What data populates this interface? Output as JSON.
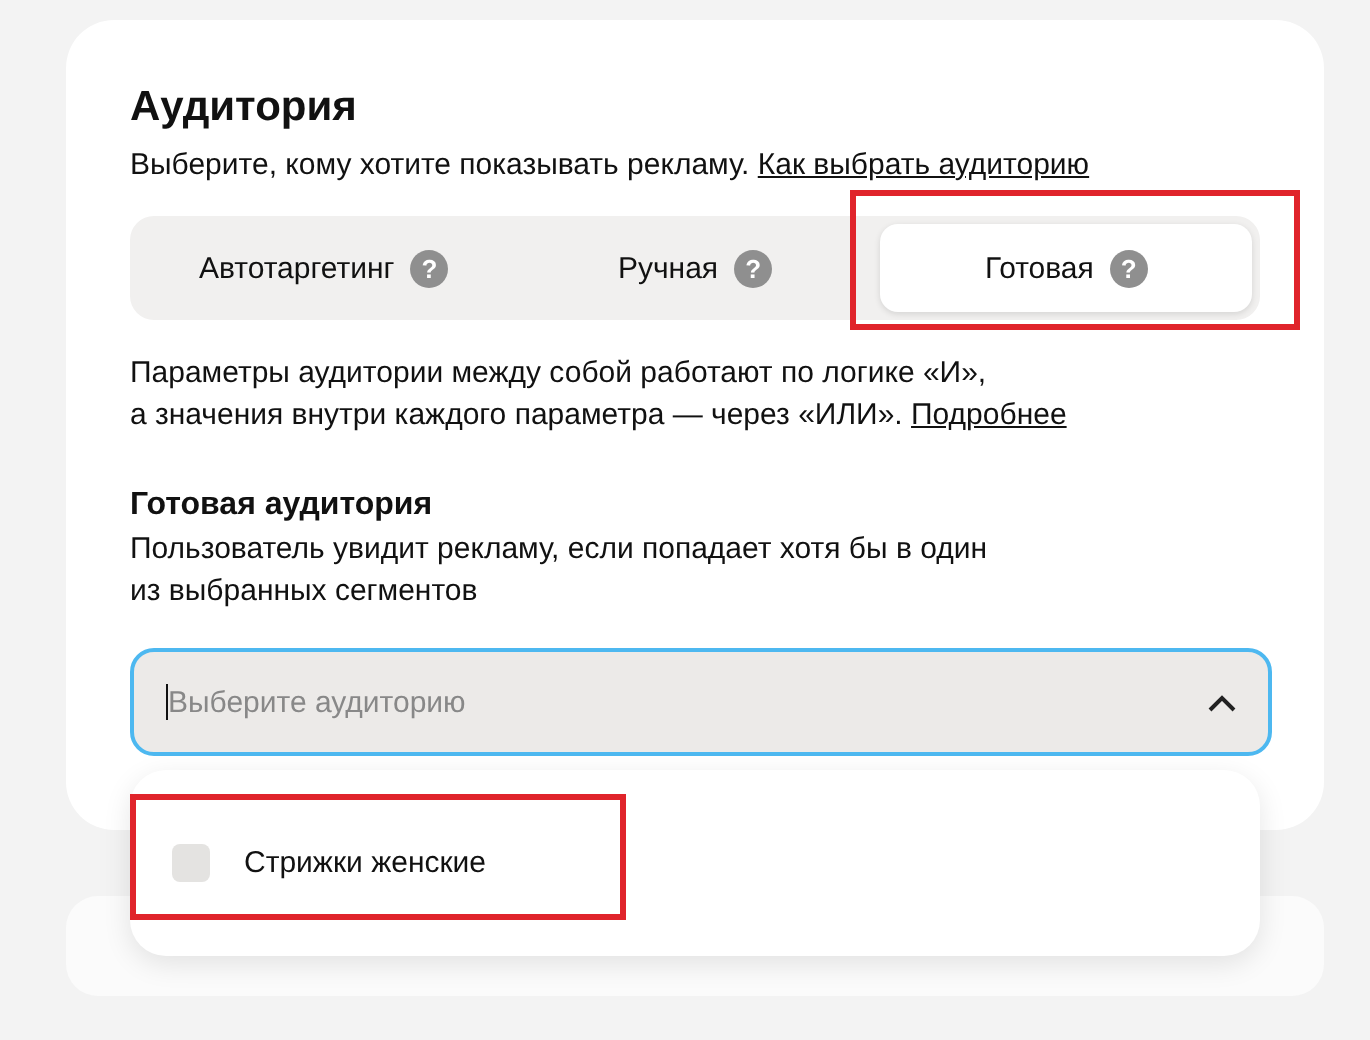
{
  "section": {
    "title": "Аудитория",
    "subtitle": "Выберите, кому хотите показывать рекламу.",
    "subtitle_link": "Как выбрать аудиторию"
  },
  "tabs": [
    {
      "label": "Автотаргетинг",
      "hint": "?",
      "selected": false
    },
    {
      "label": "Ручная",
      "hint": "?",
      "selected": false
    },
    {
      "label": "Готовая",
      "hint": "?",
      "selected": true
    }
  ],
  "logic_note": {
    "line_1": "Параметры аудитории между собой работают по логике «И»,",
    "line_2": "а значения внутри каждого параметра — через «ИЛИ».",
    "link": "Подробнее"
  },
  "ready_audience": {
    "title": "Готовая аудитория",
    "description_1": "Пользователь увидит рекламу, если попадает хотя бы в один",
    "description_2": "из выбранных сегментов",
    "field": {
      "placeholder": "Выберите аудиторию",
      "expanded": true
    }
  },
  "dropdown": {
    "options": [
      {
        "label": "Стрижки женские",
        "checked": false
      }
    ]
  }
}
